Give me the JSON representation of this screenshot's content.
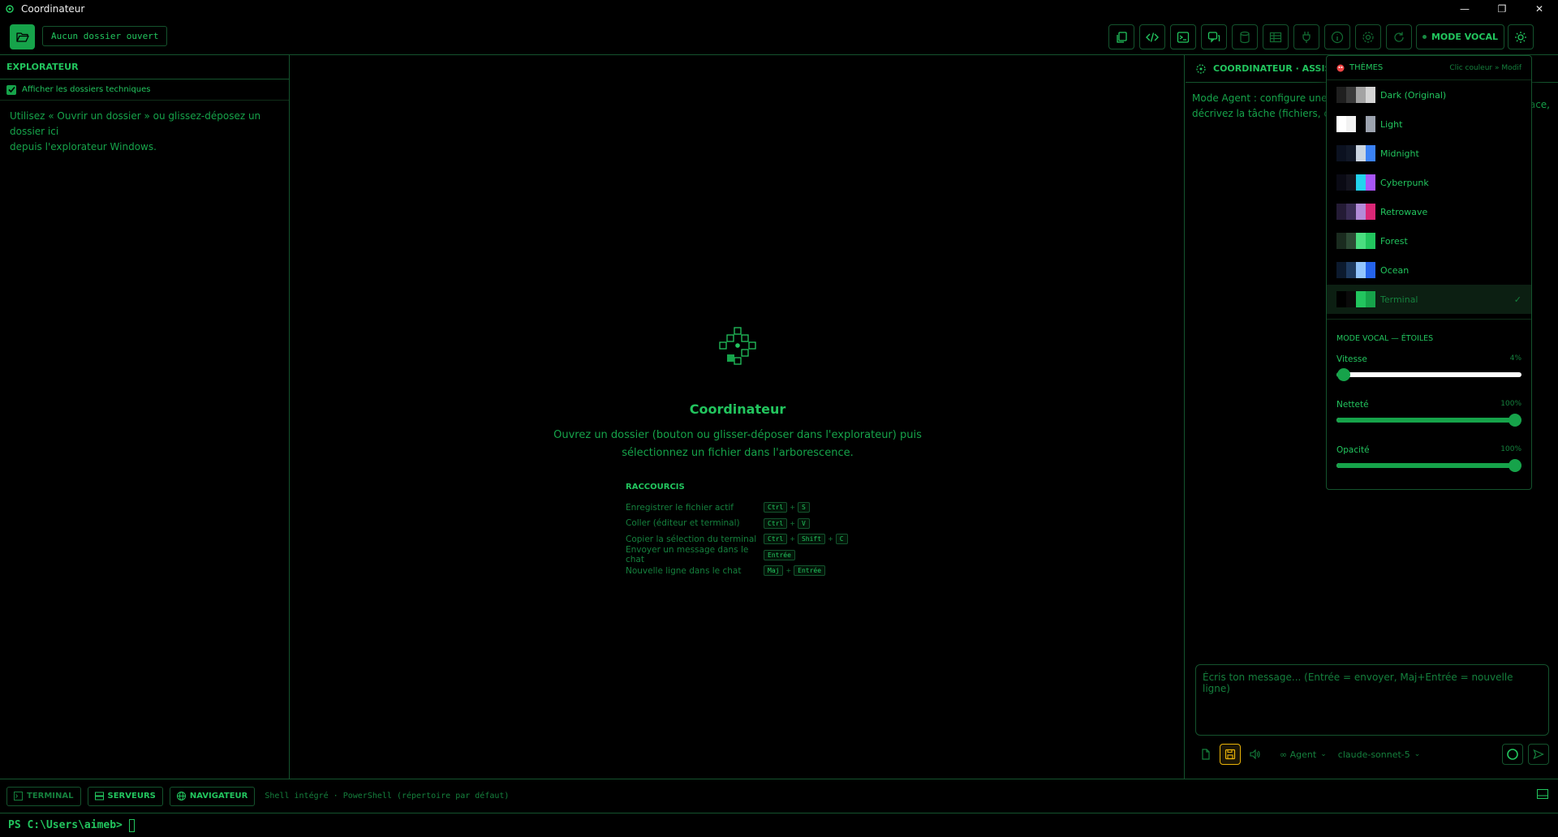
{
  "window": {
    "title": "Coordinateur",
    "controls": {
      "minimize": "—",
      "maximize": "❐",
      "close": "✕"
    }
  },
  "toolbar": {
    "folder_status": "Aucun dossier ouvert",
    "buttons": [
      "copy-icon",
      "code-icon",
      "terminal-icon",
      "chat-icon",
      "database-icon",
      "table-icon",
      "plug-icon",
      "info-icon",
      "gear-icon",
      "refresh-icon"
    ],
    "mode_vocal_label": "MODE VOCAL",
    "theme_icon": "sun-icon"
  },
  "explorer": {
    "title": "EXPLORATEUR",
    "show_technical_label": "Afficher les dossiers techniques",
    "show_technical_checked": true,
    "help_line1": "Utilisez « Ouvrir un dossier » ou glissez-déposez un dossier ici",
    "help_line2": "depuis l'explorateur Windows."
  },
  "welcome": {
    "title": "Coordinateur",
    "subtitle_line1": "Ouvrez un dossier (bouton ou glisser-déposer dans l'explorateur) puis",
    "subtitle_line2": "sélectionnez un fichier dans l'arborescence.",
    "shortcuts_title": "RACCOURCIS",
    "shortcuts": [
      {
        "label": "Enregistrer le fichier actif",
        "keys": [
          "Ctrl",
          "S"
        ]
      },
      {
        "label": "Coller (éditeur et terminal)",
        "keys": [
          "Ctrl",
          "V"
        ]
      },
      {
        "label": "Copier la sélection du terminal",
        "keys": [
          "Ctrl",
          "Shift",
          "C"
        ]
      },
      {
        "label": "Envoyer un message dans le chat",
        "keys": [
          "Entrée"
        ]
      },
      {
        "label": "Nouvelle ligne dans le chat",
        "keys": [
          "Maj",
          "Entrée"
        ]
      }
    ]
  },
  "assistant": {
    "title": "COORDINATEUR · ASSISTA",
    "desc_line1": "Mode Agent : configure une AI",
    "desc_line2": "décrivez la tâche (fichiers, com",
    "desc_tail": "ace,",
    "input_placeholder": "Écris ton message... (Entrée = envoyer, Maj+Entrée = nouvelle ligne)",
    "agent_label": "∞ Agent",
    "model_label": "claude-sonnet-5"
  },
  "themes_popup": {
    "title": "THÈMES",
    "hint": "Clic couleur » Modif",
    "selected": "Terminal",
    "themes": [
      {
        "name": "Dark (Original)",
        "colors": [
          "#1f1f1f",
          "#3a3a3a",
          "#a3a3a3",
          "#d4d4d4"
        ]
      },
      {
        "name": "Light",
        "colors": [
          "#ffffff",
          "#f2f2f2",
          "#000000",
          "#9ca3af"
        ]
      },
      {
        "name": "Midnight",
        "colors": [
          "#0b1120",
          "#111827",
          "#cbd5e1",
          "#3b82f6"
        ]
      },
      {
        "name": "Cyberpunk",
        "colors": [
          "#0a0a14",
          "#14141f",
          "#22d3ee",
          "#a855f7"
        ]
      },
      {
        "name": "Retrowave",
        "colors": [
          "#241b35",
          "#3b2d55",
          "#b38bd8",
          "#db2777"
        ]
      },
      {
        "name": "Forest",
        "colors": [
          "#1a2b1f",
          "#2d4a35",
          "#4ade80",
          "#22c55e"
        ]
      },
      {
        "name": "Ocean",
        "colors": [
          "#0c1a2e",
          "#1e3a5f",
          "#93c5fd",
          "#2563eb"
        ]
      },
      {
        "name": "Terminal",
        "colors": [
          "#000000",
          "#0a0a0a",
          "#22c55e",
          "#16a34a"
        ]
      }
    ],
    "vocal_title": "MODE VOCAL — ÉTOILES",
    "sliders": [
      {
        "label": "Vitesse",
        "value_text": "4%",
        "value": 0.04
      },
      {
        "label": "Netteté",
        "value_text": "100%",
        "value": 1.0
      },
      {
        "label": "Opacité",
        "value_text": "100%",
        "value": 1.0
      }
    ]
  },
  "bottom": {
    "tabs": [
      "TERMINAL",
      "SERVEURS",
      "NAVIGATEUR"
    ],
    "active_tab": "TERMINAL",
    "shell_desc": "Shell intégré · PowerShell (répertoire par défaut)",
    "prompt": "PS C:\\Users\\aimeb>"
  },
  "colors": {
    "accent": "#22c55e",
    "accent_dark": "#16a34a",
    "border": "#14532d",
    "background": "#000000",
    "highlight": "#eab308"
  }
}
